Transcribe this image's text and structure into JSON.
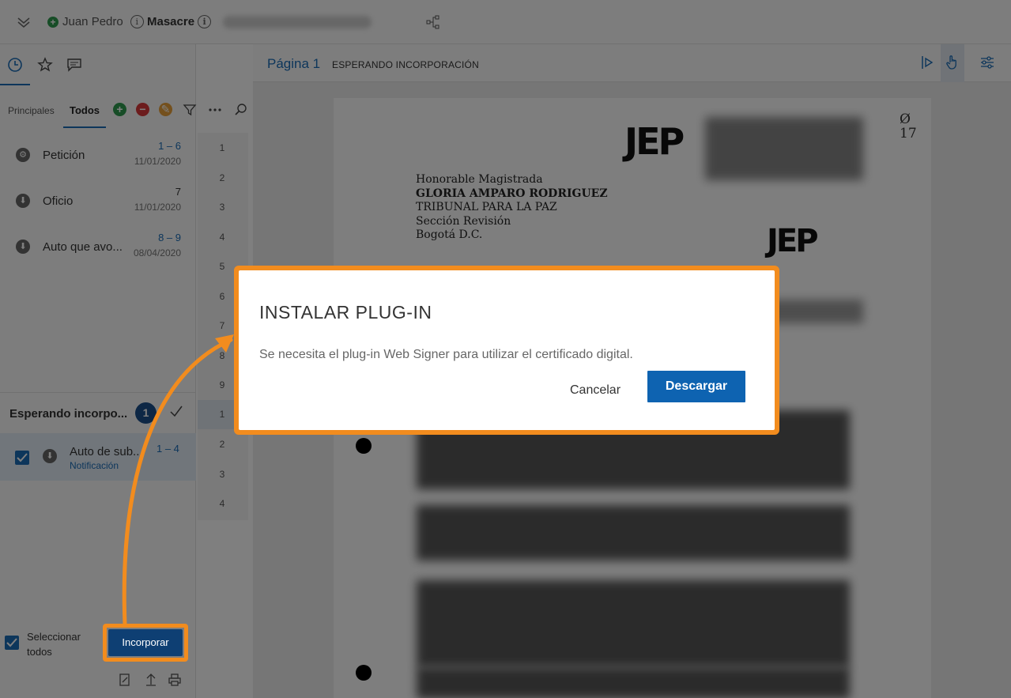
{
  "topbar": {
    "user": "Juan Pedro",
    "case": "Masacre"
  },
  "left_panel": {
    "filters": {
      "principales": "Principales",
      "todos": "Todos"
    },
    "documents": [
      {
        "name": "Petición",
        "range": "1 – 6",
        "date": "11/01/2020"
      },
      {
        "name": "Oficio",
        "range": "7",
        "date": "11/01/2020"
      },
      {
        "name": "Auto que avo...",
        "range": "8 – 9",
        "date": "08/04/2020"
      }
    ],
    "pending": {
      "title": "Esperando incorpo...",
      "count": "1",
      "item_name": "Auto de sub...",
      "item_sub": "Notificación",
      "item_range": "1 – 4"
    },
    "select_all": "Seleccionar todos",
    "incorporar_label": "Incorporar"
  },
  "page_strip": {
    "group1": [
      "1",
      "2",
      "3",
      "4",
      "5",
      "6",
      "7",
      "8",
      "9"
    ],
    "group2": [
      "1",
      "2",
      "3",
      "4"
    ]
  },
  "toolbar": {
    "page_label": "Página 1",
    "status": "ESPERANDO INCORPORACIÓN"
  },
  "document": {
    "logo_text": "JEP",
    "stamp": "Ø\n17",
    "address": [
      "Honorable Magistrada",
      "GLORIA AMPARO RODRIGUEZ",
      "TRIBUNAL PARA LA PAZ",
      "Sección Revisión",
      "Bogotá D.C."
    ]
  },
  "dialog": {
    "title": "INSTALAR PLUG-IN",
    "message": "Se necesita el plug-in Web Signer para utilizar el certificado digital.",
    "cancel_label": "Cancelar",
    "download_label": "Descargar"
  },
  "colors": {
    "accent": "#1a6cb7",
    "highlight": "#f28c1e",
    "primary_button": "#0e63b1"
  }
}
